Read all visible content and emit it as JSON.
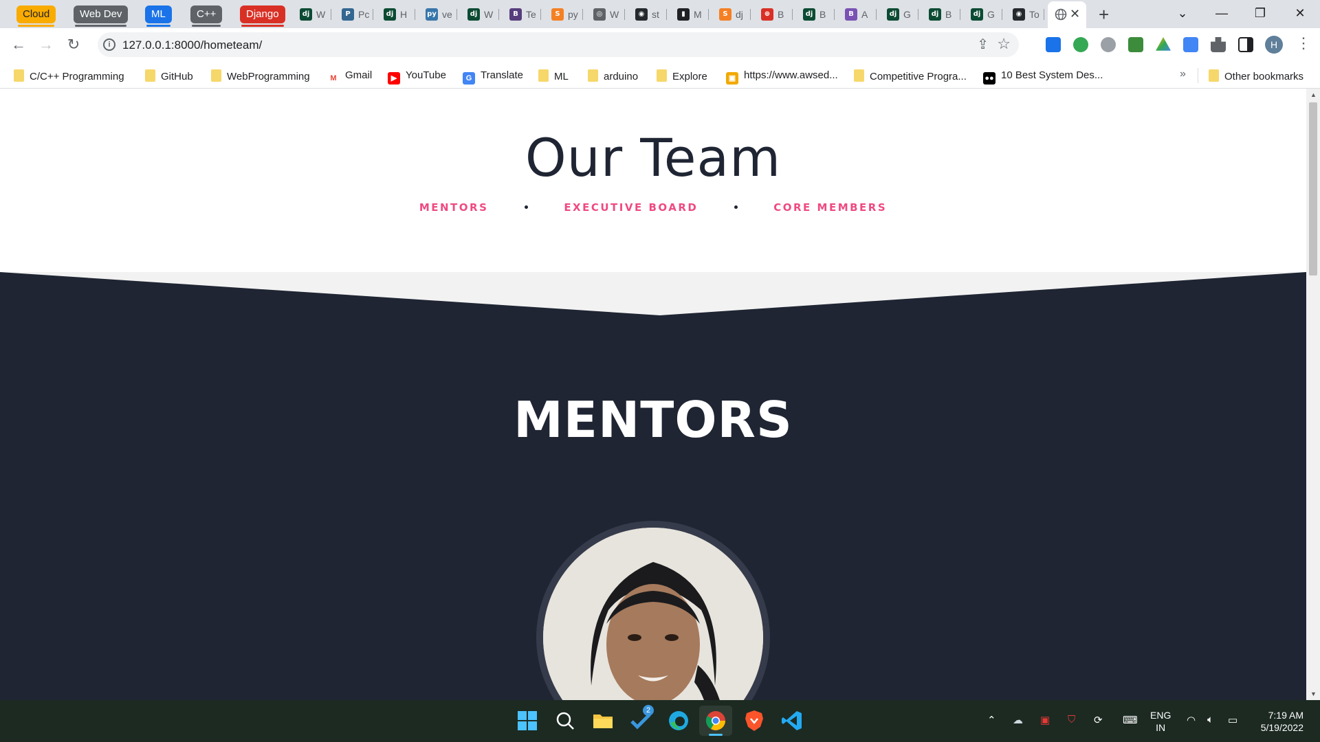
{
  "tab_groups": [
    {
      "label": "Cloud",
      "color": "#f9ab00",
      "text_color": "#202124"
    },
    {
      "label": "Web Dev",
      "color": "#5f6368",
      "text_color": "#ffffff"
    },
    {
      "label": "ML",
      "color": "#1a73e8",
      "text_color": "#ffffff"
    },
    {
      "label": "C++",
      "color": "#5f6368",
      "text_color": "#ffffff"
    },
    {
      "label": "Django",
      "color": "#d93025",
      "text_color": "#ffffff"
    }
  ],
  "tabs": [
    {
      "icon": "django-icon",
      "fav": "dj",
      "color": "#0c4b33",
      "title": "W"
    },
    {
      "icon": "postgres-icon",
      "fav": "P",
      "color": "#336791",
      "title": "Pc"
    },
    {
      "icon": "django-icon",
      "fav": "dj",
      "color": "#0c4b33",
      "title": "H"
    },
    {
      "icon": "python-icon",
      "fav": "py",
      "color": "#3776ab",
      "title": "ve"
    },
    {
      "icon": "django-icon",
      "fav": "dj",
      "color": "#0c4b33",
      "title": "W"
    },
    {
      "icon": "bootstrap-icon",
      "fav": "B",
      "color": "#563d7c",
      "title": "Te"
    },
    {
      "icon": "stackoverflow-icon",
      "fav": "S",
      "color": "#f48024",
      "title": "py"
    },
    {
      "icon": "globe-icon",
      "fav": "◎",
      "color": "#5f6368",
      "title": "W"
    },
    {
      "icon": "github-icon",
      "fav": "◉",
      "color": "#24292e",
      "title": "st"
    },
    {
      "icon": "briefcase-icon",
      "fav": "▮",
      "color": "#202124",
      "title": "M"
    },
    {
      "icon": "stackoverflow-icon",
      "fav": "S",
      "color": "#f48024",
      "title": "dj"
    },
    {
      "icon": "lifebuoy-icon",
      "fav": "⊕",
      "color": "#d93025",
      "title": "B"
    },
    {
      "icon": "django-icon",
      "fav": "dj",
      "color": "#0c4b33",
      "title": "B"
    },
    {
      "icon": "bootstrap-icon",
      "fav": "B",
      "color": "#7952b3",
      "title": "A"
    },
    {
      "icon": "django-icon",
      "fav": "dj",
      "color": "#0c4b33",
      "title": "G"
    },
    {
      "icon": "django-icon",
      "fav": "dj",
      "color": "#0c4b33",
      "title": "B"
    },
    {
      "icon": "django-icon",
      "fav": "dj",
      "color": "#0c4b33",
      "title": "G"
    },
    {
      "icon": "github-icon",
      "fav": "◉",
      "color": "#24292e",
      "title": "To"
    }
  ],
  "toolbar": {
    "url": "127.0.0.1:8000/hometeam/"
  },
  "bookmarks": [
    {
      "label": "C/C++ Programming",
      "type": "folder"
    },
    {
      "label": "GitHub",
      "type": "folder"
    },
    {
      "label": "WebProgramming",
      "type": "folder"
    },
    {
      "label": "Gmail",
      "type": "gmail"
    },
    {
      "label": "YouTube",
      "type": "youtube"
    },
    {
      "label": "Translate",
      "type": "translate"
    },
    {
      "label": "ML",
      "type": "folder"
    },
    {
      "label": "arduino",
      "type": "folder"
    },
    {
      "label": "Explore",
      "type": "folder"
    },
    {
      "label": "https://www.awsed...",
      "type": "aws"
    },
    {
      "label": "Competitive Progra...",
      "type": "folder"
    },
    {
      "label": "10 Best System Des...",
      "type": "medium"
    }
  ],
  "bookmarks_overflow": "»",
  "other_bookmarks": "Other bookmarks",
  "page": {
    "title": "Our Team",
    "nav": [
      "MENTORS",
      "EXECUTIVE BOARD",
      "CORE MEMBERS"
    ],
    "section_title": "MENTORS",
    "colors": {
      "dark": "#1f2533",
      "accent": "#ef4a82",
      "band": "#f2f2f2"
    }
  },
  "taskbar": {
    "badge_count": "2",
    "language": "ENG",
    "region": "IN",
    "time": "7:19 AM",
    "date": "5/19/2022"
  }
}
